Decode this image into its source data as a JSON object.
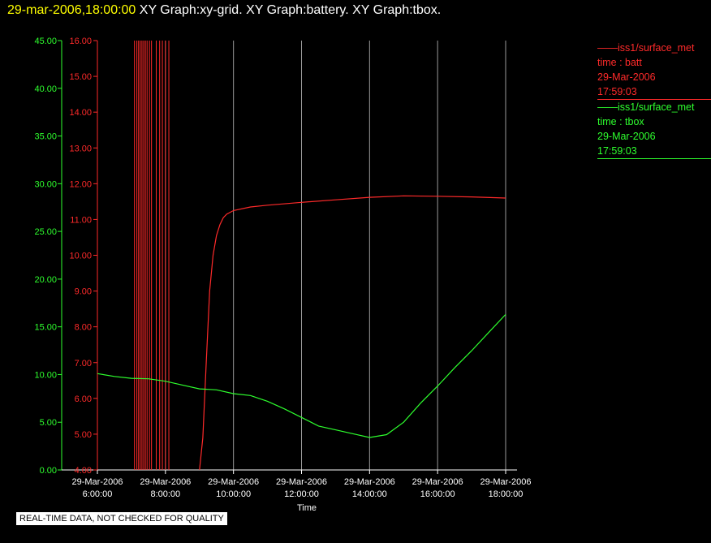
{
  "header": {
    "timestamp": "29-mar-2006,18:00:00",
    "graphs": "XY Graph:xy-grid.  XY Graph:battery.  XY Graph:tbox."
  },
  "legend": {
    "entries": [
      {
        "line": "——iss1/surface_met",
        "vars": "time : batt",
        "date": "29-Mar-2006",
        "time": "17:59:03",
        "color": "#ff2a2a"
      },
      {
        "line": "——iss1/surface_met",
        "vars": "time : tbox",
        "date": "29-Mar-2006",
        "time": "17:59:03",
        "color": "#2eff2e"
      }
    ]
  },
  "notice": "REAL-TIME DATA, NOT CHECKED FOR QUALITY",
  "chart_data": {
    "type": "line",
    "title": "",
    "xlabel": "Time",
    "x_ticks": [
      {
        "date": "29-Mar-2006",
        "time": "6:00:00"
      },
      {
        "date": "29-Mar-2006",
        "time": "8:00:00"
      },
      {
        "date": "29-Mar-2006",
        "time": "10:00:00"
      },
      {
        "date": "29-Mar-2006",
        "time": "12:00:00"
      },
      {
        "date": "29-Mar-2006",
        "time": "14:00:00"
      },
      {
        "date": "29-Mar-2006",
        "time": "16:00:00"
      },
      {
        "date": "29-Mar-2006",
        "time": "18:00:00"
      }
    ],
    "x_tick_hours": [
      6,
      8,
      10,
      12,
      14,
      16,
      18
    ],
    "xlim_hours": [
      6,
      18.3
    ],
    "y_left_outer": {
      "name": "tbox",
      "ylim": [
        0,
        45
      ],
      "ticks": [
        "0.00",
        "5.00",
        "10.00",
        "15.00",
        "20.00",
        "25.00",
        "30.00",
        "35.00",
        "40.00",
        "45.00"
      ],
      "color": "#2eff2e"
    },
    "y_left_inner": {
      "name": "batt",
      "ylim": [
        4,
        16
      ],
      "ticks": [
        "4.00",
        "5.00",
        "6.00",
        "7.00",
        "8.00",
        "9.00",
        "10.00",
        "11.00",
        "12.00",
        "13.00",
        "14.00",
        "15.00",
        "16.00"
      ],
      "color": "#ff2a2a"
    },
    "grid": true,
    "series": [
      {
        "axis": "inner",
        "color": "#ff2a2a",
        "spikes_hours": [
          7.09,
          7.16,
          7.21,
          7.26,
          7.31,
          7.36,
          7.41,
          7.46,
          7.53,
          7.59,
          7.73,
          7.83,
          7.91,
          8.0,
          8.1
        ],
        "points": [
          [
            9.0,
            4.0
          ],
          [
            9.1,
            4.9
          ],
          [
            9.2,
            7.0
          ],
          [
            9.3,
            9.0
          ],
          [
            9.4,
            10.0
          ],
          [
            9.5,
            10.55
          ],
          [
            9.6,
            10.85
          ],
          [
            9.7,
            11.05
          ],
          [
            9.8,
            11.15
          ],
          [
            10.0,
            11.25
          ],
          [
            10.5,
            11.35
          ],
          [
            11.0,
            11.4
          ],
          [
            12.0,
            11.48
          ],
          [
            13.0,
            11.55
          ],
          [
            14.0,
            11.62
          ],
          [
            15.0,
            11.66
          ],
          [
            16.0,
            11.65
          ],
          [
            17.0,
            11.63
          ],
          [
            18.0,
            11.6
          ]
        ]
      },
      {
        "axis": "outer",
        "color": "#2eff2e",
        "points": [
          [
            6.0,
            10.1
          ],
          [
            6.5,
            9.8
          ],
          [
            7.0,
            9.6
          ],
          [
            7.5,
            9.55
          ],
          [
            8.0,
            9.3
          ],
          [
            8.5,
            8.9
          ],
          [
            9.0,
            8.5
          ],
          [
            9.5,
            8.4
          ],
          [
            10.0,
            8.0
          ],
          [
            10.5,
            7.8
          ],
          [
            11.0,
            7.2
          ],
          [
            11.5,
            6.4
          ],
          [
            12.0,
            5.5
          ],
          [
            12.5,
            4.6
          ],
          [
            13.0,
            4.2
          ],
          [
            13.5,
            3.8
          ],
          [
            14.0,
            3.4
          ],
          [
            14.5,
            3.7
          ],
          [
            15.0,
            5.0
          ],
          [
            15.5,
            7.0
          ],
          [
            16.0,
            8.8
          ],
          [
            16.5,
            10.7
          ],
          [
            17.0,
            12.5
          ],
          [
            17.5,
            14.4
          ],
          [
            18.0,
            16.3
          ]
        ]
      }
    ]
  }
}
